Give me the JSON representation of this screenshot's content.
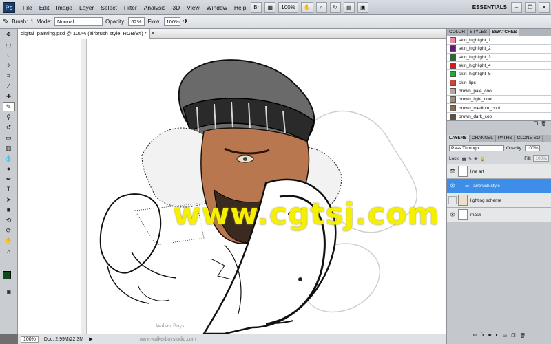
{
  "menubar": {
    "logo": "Ps",
    "items": [
      "File",
      "Edit",
      "Image",
      "Layer",
      "Select",
      "Filter",
      "Analysis",
      "3D",
      "View",
      "Window",
      "Help"
    ],
    "zoom": "100%",
    "workspace": "ESSENTIALS"
  },
  "options": {
    "brush_label": "Brush:",
    "brush_size": "1",
    "mode_label": "Mode:",
    "mode_value": "Normal",
    "opacity_label": "Opacity:",
    "opacity_value": "62%",
    "flow_label": "Flow:",
    "flow_value": "100%"
  },
  "document": {
    "tab_title": "digital_painting.psd @ 100% (airbrush style, RGB/8#) *"
  },
  "statusbar": {
    "zoom": "100%",
    "doc": "Doc: 2.99M/22.3M"
  },
  "swatches_panel": {
    "tabs": [
      "COLOR",
      "STYLES",
      "SWATCHES"
    ],
    "items": [
      {
        "name": "skin_highlight_1",
        "color": "#e88aa1"
      },
      {
        "name": "skin_highlight_2",
        "color": "#5b1f6e"
      },
      {
        "name": "skin_highlight_3",
        "color": "#1f6d2f"
      },
      {
        "name": "skin_highlight_4",
        "color": "#d11c22"
      },
      {
        "name": "skin_highlight_5",
        "color": "#2aa63a"
      },
      {
        "name": "skin_lips",
        "color": "#c24a3a"
      },
      {
        "name": "brown_pale_cool",
        "color": "#b7a899"
      },
      {
        "name": "brown_light_cool",
        "color": "#9b8c7b"
      },
      {
        "name": "brown_medium_cool",
        "color": "#7d6e5f"
      },
      {
        "name": "brown_dark_cool",
        "color": "#5e5045"
      }
    ]
  },
  "layers_panel": {
    "tabs": [
      "LAYERS",
      "CHANNEL",
      "PATHS",
      "CLONE SO"
    ],
    "blend": "Pass Through",
    "opacity_label": "Opacity:",
    "opacity_value": "100%",
    "lock_label": "Lock:",
    "fill_label": "Fill:",
    "fill_value": "100%",
    "layers": [
      {
        "name": "line art",
        "visible": true,
        "selected": false
      },
      {
        "name": "airbrush style",
        "visible": true,
        "selected": true
      },
      {
        "name": "lighting scheme",
        "visible": false,
        "selected": false
      },
      {
        "name": "mask",
        "visible": true,
        "selected": false
      }
    ]
  },
  "watermark": "www.cgtsj.com",
  "canvas_credit": {
    "name": "Walker Boys",
    "url": "www.walkerboystudio.com"
  }
}
